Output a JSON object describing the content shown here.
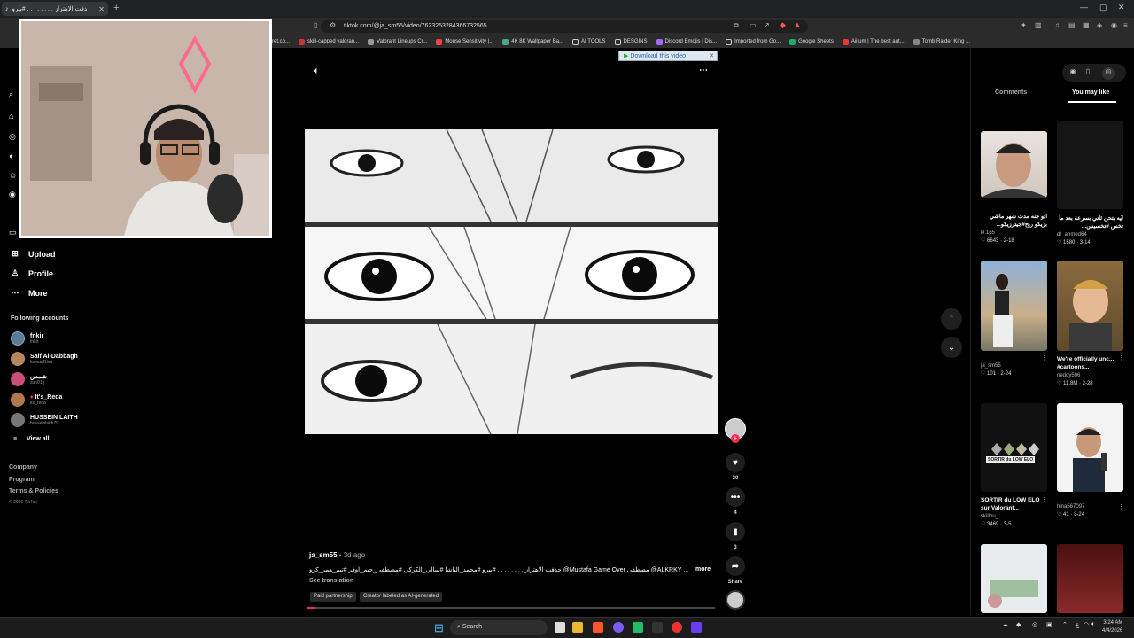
{
  "browser": {
    "tab_title": "حذفت الاهتزاز . . . . . . . . #بيرو",
    "url": "tiktok.com/@ja_sm55/video/7623253284366732565",
    "bookmarks": [
      "ret.co...",
      "skill-capped valoran...",
      "Valorant Lineups Cr...",
      "Mouse Sensitivity |...",
      "4K 8K Wallpaper Ba...",
      "AI TOOLS",
      "DESGINS",
      "Discord Emojis | Dis...",
      "Imported from Go...",
      "Google Sheets",
      "Aiitum | The best aut...",
      "Tomb Raider King ..."
    ],
    "extension_label": "Download this video"
  },
  "sidebar": {
    "nav": [
      {
        "label": "Upload",
        "icon": "plus-square-icon"
      },
      {
        "label": "Profile",
        "icon": "person-icon"
      },
      {
        "label": "More",
        "icon": "ellipsis-icon"
      }
    ],
    "following_header": "Following accounts",
    "accounts": [
      {
        "name": "fnkir",
        "handle": "fnkir",
        "color": "#5b7c99"
      },
      {
        "name": "Saif Al-Dabbagh",
        "handle": "kensaif1ion",
        "color": "#b7885e"
      },
      {
        "name": "شمس",
        "handle": "sun01lj",
        "color": "#c94f7c"
      },
      {
        "name": "It's_Reda",
        "handle": "its_reda",
        "color": "#b0774b"
      },
      {
        "name": "HUSSEIN LAITH",
        "handle": "husseinlaith79",
        "color": "#777"
      }
    ],
    "view_all": "View all",
    "footer": [
      "Company",
      "Program",
      "Terms & Policies"
    ],
    "copyright": "© 2026 TikTok"
  },
  "video": {
    "author": "ja_sm55",
    "time_ago": "3d ago",
    "caption": "حذفت الاهتزاز . . . . . . . . #بيرو #محمد_الباشا #سالي_الكركي #مصطفى_جيم_اوفر #تيم_همر_كرو @Mustafa Game Over مصطفى @ALKRKY ...",
    "more": "more",
    "see_translation": "See translation",
    "pills": [
      "Paid partnership",
      "Creator labeled as AI-generated"
    ],
    "progress": 0.02,
    "actions": {
      "likes": "30",
      "comments": "4",
      "saves": "3",
      "share": "Share"
    }
  },
  "right_panel": {
    "tabs": [
      "Comments",
      "You may like"
    ],
    "active_tab": "You may like",
    "cards": [
      {
        "title": "ابو جنه مدت شهر ماشي بزيكو ربح#جيترزيكو...",
        "user": "kl.165",
        "likes": "6643",
        "date": "2-18"
      },
      {
        "title": "ليه بتحن ثاني بسرعة بعد ما تخس #تخسيس...",
        "user": "dr_ahmed64",
        "likes": "1580",
        "date": "3-14"
      },
      {
        "title": "",
        "user": "ja_sm55",
        "likes": "101",
        "date": "2-24"
      },
      {
        "title": "We're officially unc... #cartoons...",
        "user": "neddy596",
        "likes": "11.8M",
        "date": "2-28"
      },
      {
        "title": "SORTIR du LOW ELO sur Valorant...",
        "user": "skillou_",
        "likes": "3469",
        "date": "3-5"
      },
      {
        "title": "",
        "user": "hina567097",
        "likes": "41",
        "date": "3-24"
      }
    ],
    "thumb_texts": {
      "sortir": "SORTIR du LOW ELO"
    }
  },
  "taskbar": {
    "search": "Search",
    "time": "3:24 AM",
    "date": "4/4/2026"
  }
}
